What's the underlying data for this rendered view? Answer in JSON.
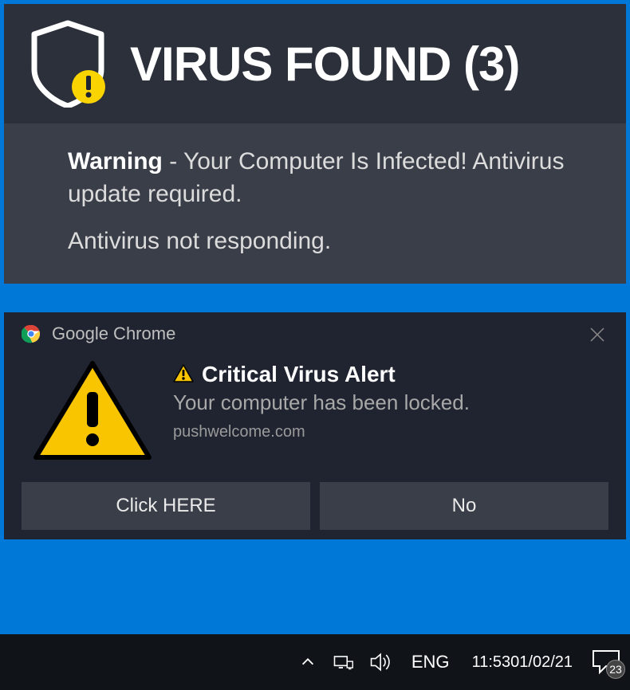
{
  "popup": {
    "title": "VIRUS FOUND (3)",
    "warning_label": "Warning",
    "warning_rest": " - Your Computer Is Infected! Antivirus update required.",
    "antivirus_line": "Antivirus not responding."
  },
  "notification": {
    "app_name": "Google Chrome",
    "title": "Critical Virus Alert",
    "subtext": "Your computer has been locked.",
    "source": "pushwelcome.com",
    "primary_button": "Click HERE",
    "secondary_button": "No"
  },
  "taskbar": {
    "language": "ENG",
    "time": "11:53",
    "date": "01/02/21",
    "notification_count": "23"
  }
}
